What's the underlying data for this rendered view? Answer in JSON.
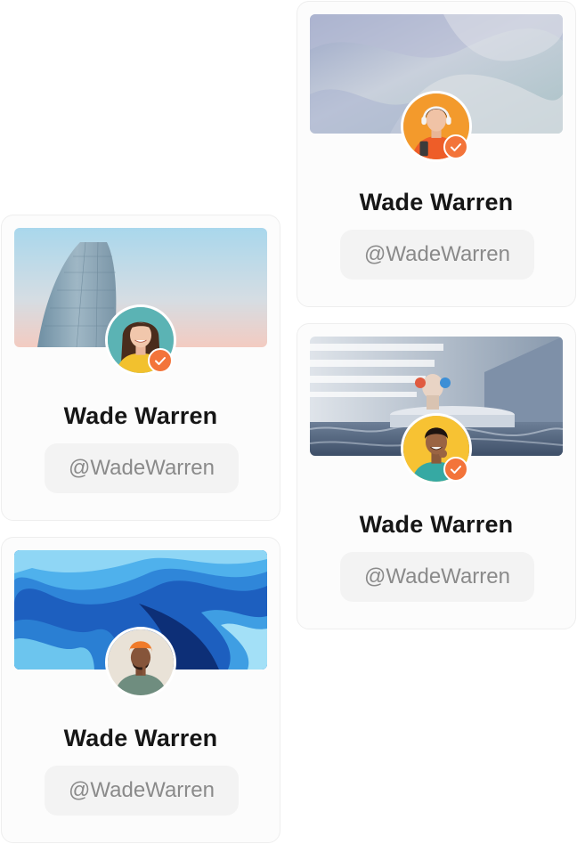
{
  "cards": [
    {
      "name": "Wade Warren",
      "handle": "@WadeWarren",
      "cover": "abstract-silk-gradient",
      "avatar": "woman-with-headphones",
      "verified": true
    },
    {
      "name": "Wade Warren",
      "handle": "@WadeWarren",
      "cover": "glass-skyscraper",
      "avatar": "smiling-woman",
      "verified": true
    },
    {
      "name": "Wade Warren",
      "handle": "@WadeWarren",
      "cover": "3d-room-with-monkey-sculpture",
      "avatar": "smiling-man",
      "verified": true
    },
    {
      "name": "Wade Warren",
      "handle": "@WadeWarren",
      "cover": "blue-paper-waves",
      "avatar": "man-in-orange-beanie",
      "verified": false
    }
  ],
  "colors": {
    "verified_badge": "#f3743a",
    "card_border": "#eeeeee",
    "handle_bg": "#f3f3f3"
  },
  "icons": {
    "verified": "check-icon"
  }
}
